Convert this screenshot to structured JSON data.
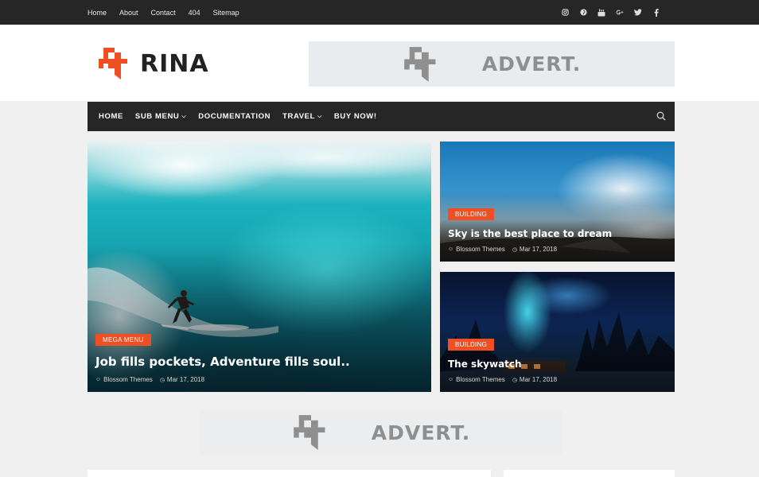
{
  "topbar": {
    "links": [
      "Home",
      "About",
      "Contact",
      "404",
      "Sitemap"
    ],
    "social_icons": [
      "instagram-icon",
      "pinterest-icon",
      "youtube-icon",
      "google-plus-icon",
      "twitter-icon",
      "facebook-icon"
    ]
  },
  "header": {
    "logo_text": "RINA",
    "advert_text": "ADVERT.",
    "brand_color": "#f04e23"
  },
  "nav": {
    "items": [
      {
        "label": "HOME",
        "dropdown": false
      },
      {
        "label": "SUB MENU",
        "dropdown": true
      },
      {
        "label": "DOCUMENTATION",
        "dropdown": false
      },
      {
        "label": "TRAVEL",
        "dropdown": true
      },
      {
        "label": "BUY NOW!",
        "dropdown": false
      }
    ]
  },
  "featured": {
    "main": {
      "category": "MEGA MENU",
      "title": "Job fills pockets, Adventure fills soul..",
      "author": "Blossom Themes",
      "date": "Mar 17, 2018"
    },
    "side": [
      {
        "category": "BUILDING",
        "title": "Sky is the best place to dream",
        "author": "Blossom Themes",
        "date": "Mar 17, 2018"
      },
      {
        "category": "BUILDING",
        "title": "The skywatch",
        "author": "Blossom Themes",
        "date": "Mar 17, 2018"
      }
    ]
  },
  "advert_mid": {
    "text": "ADVERT."
  }
}
